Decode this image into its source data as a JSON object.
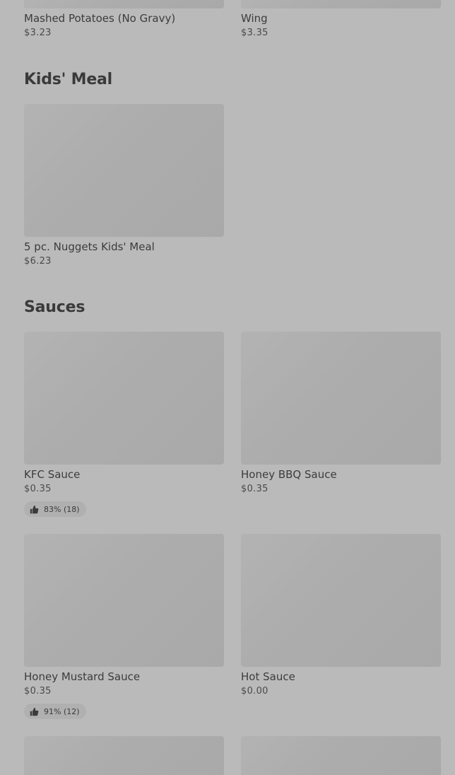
{
  "top_items": [
    {
      "name": "Mashed Potatoes (No Gravy)",
      "price": "$3.23"
    },
    {
      "name": "Wing",
      "price": "$3.35"
    }
  ],
  "kids_meal": {
    "title": "Kids' Meal",
    "items": [
      {
        "name": "5 pc. Nuggets Kids' Meal",
        "price": "$6.23"
      }
    ]
  },
  "sauces": {
    "title": "Sauces",
    "items": [
      {
        "name": "KFC Sauce",
        "price": "$0.35",
        "rating": "83% (18)"
      },
      {
        "name": "Honey BBQ Sauce",
        "price": "$0.35"
      },
      {
        "name": "Honey Mustard Sauce",
        "price": "$0.35",
        "rating": "91% (12)"
      },
      {
        "name": "Hot Sauce",
        "price": "$0.00"
      }
    ]
  },
  "icons": {
    "rating": "thumbs-up-icon"
  }
}
